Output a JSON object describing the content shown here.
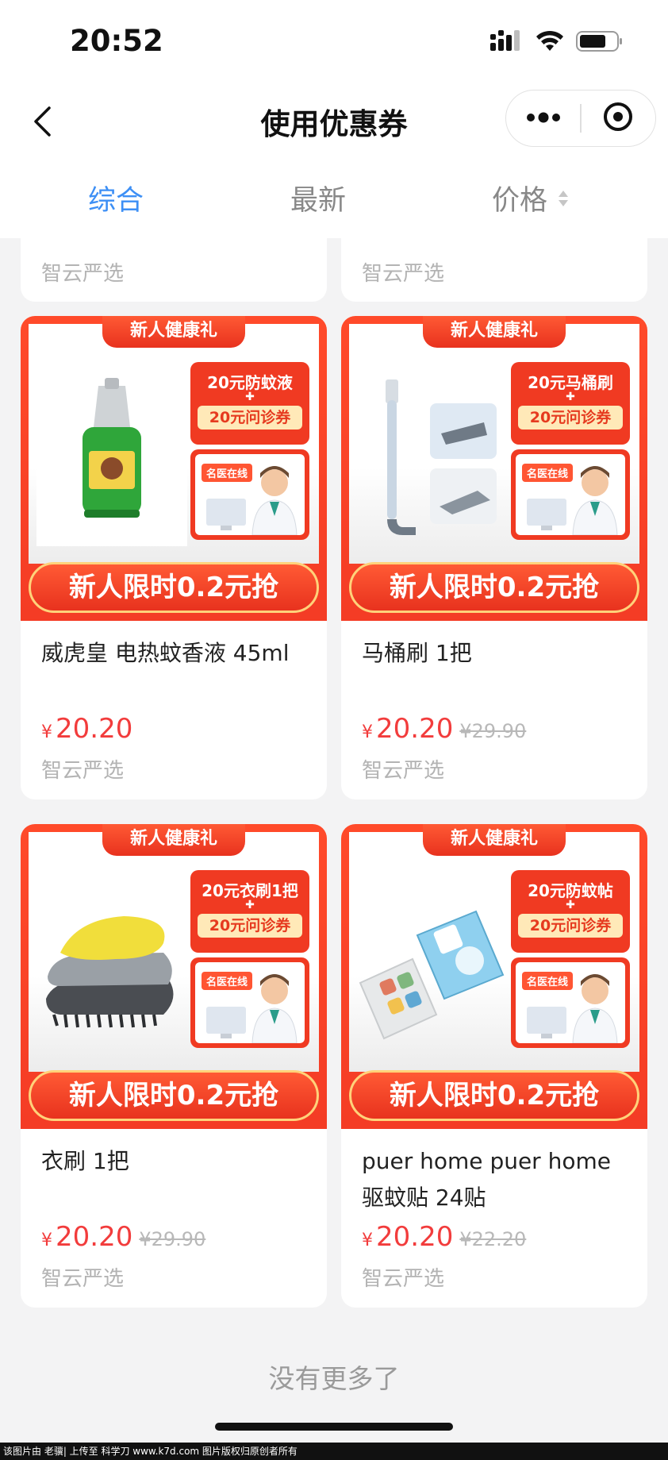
{
  "status_bar": {
    "time": "20:52"
  },
  "nav": {
    "title": "使用优惠券"
  },
  "filter_tabs": [
    {
      "label": "综合",
      "active": true
    },
    {
      "label": "最新",
      "active": false
    },
    {
      "label": "价格",
      "active": false
    }
  ],
  "partial_cards": [
    {
      "shop": "智云严选"
    },
    {
      "shop": "智云严选"
    }
  ],
  "promo": {
    "ribbon": "新人健康礼",
    "coupon_secondary": "20元问诊券",
    "doctor_tag": "名医在线",
    "cta": "新人限时0.2元抢"
  },
  "products": [
    {
      "coupon_primary": "20元防蚊液",
      "name": "威虎皇 电热蚊香液 45ml",
      "price": "20.20",
      "original_price": "",
      "shop": "智云严选",
      "visual": "mosquito-liquid"
    },
    {
      "coupon_primary": "20元马桶刷",
      "name": "马桶刷 1把",
      "price": "20.20",
      "original_price": "¥29.90",
      "shop": "智云严选",
      "visual": "toilet-brush"
    },
    {
      "coupon_primary": "20元衣刷1把",
      "name": "衣刷 1把",
      "price": "20.20",
      "original_price": "¥29.90",
      "shop": "智云严选",
      "visual": "clothes-brush"
    },
    {
      "coupon_primary": "20元防蚊帖",
      "name": "puer home puer home 驱蚊贴 24贴",
      "price": "20.20",
      "original_price": "¥22.20",
      "shop": "智云严选",
      "visual": "mosquito-patch"
    }
  ],
  "currency_symbol": "¥",
  "footer": {
    "no_more": "没有更多了"
  },
  "watermark": "该图片由 老骥| 上传至 科学刀 www.k7d.com 图片版权归原创者所有",
  "colors": {
    "accent_blue": "#3d8ff5",
    "price_red": "#f23c3c",
    "promo_red": "#f03a22"
  }
}
